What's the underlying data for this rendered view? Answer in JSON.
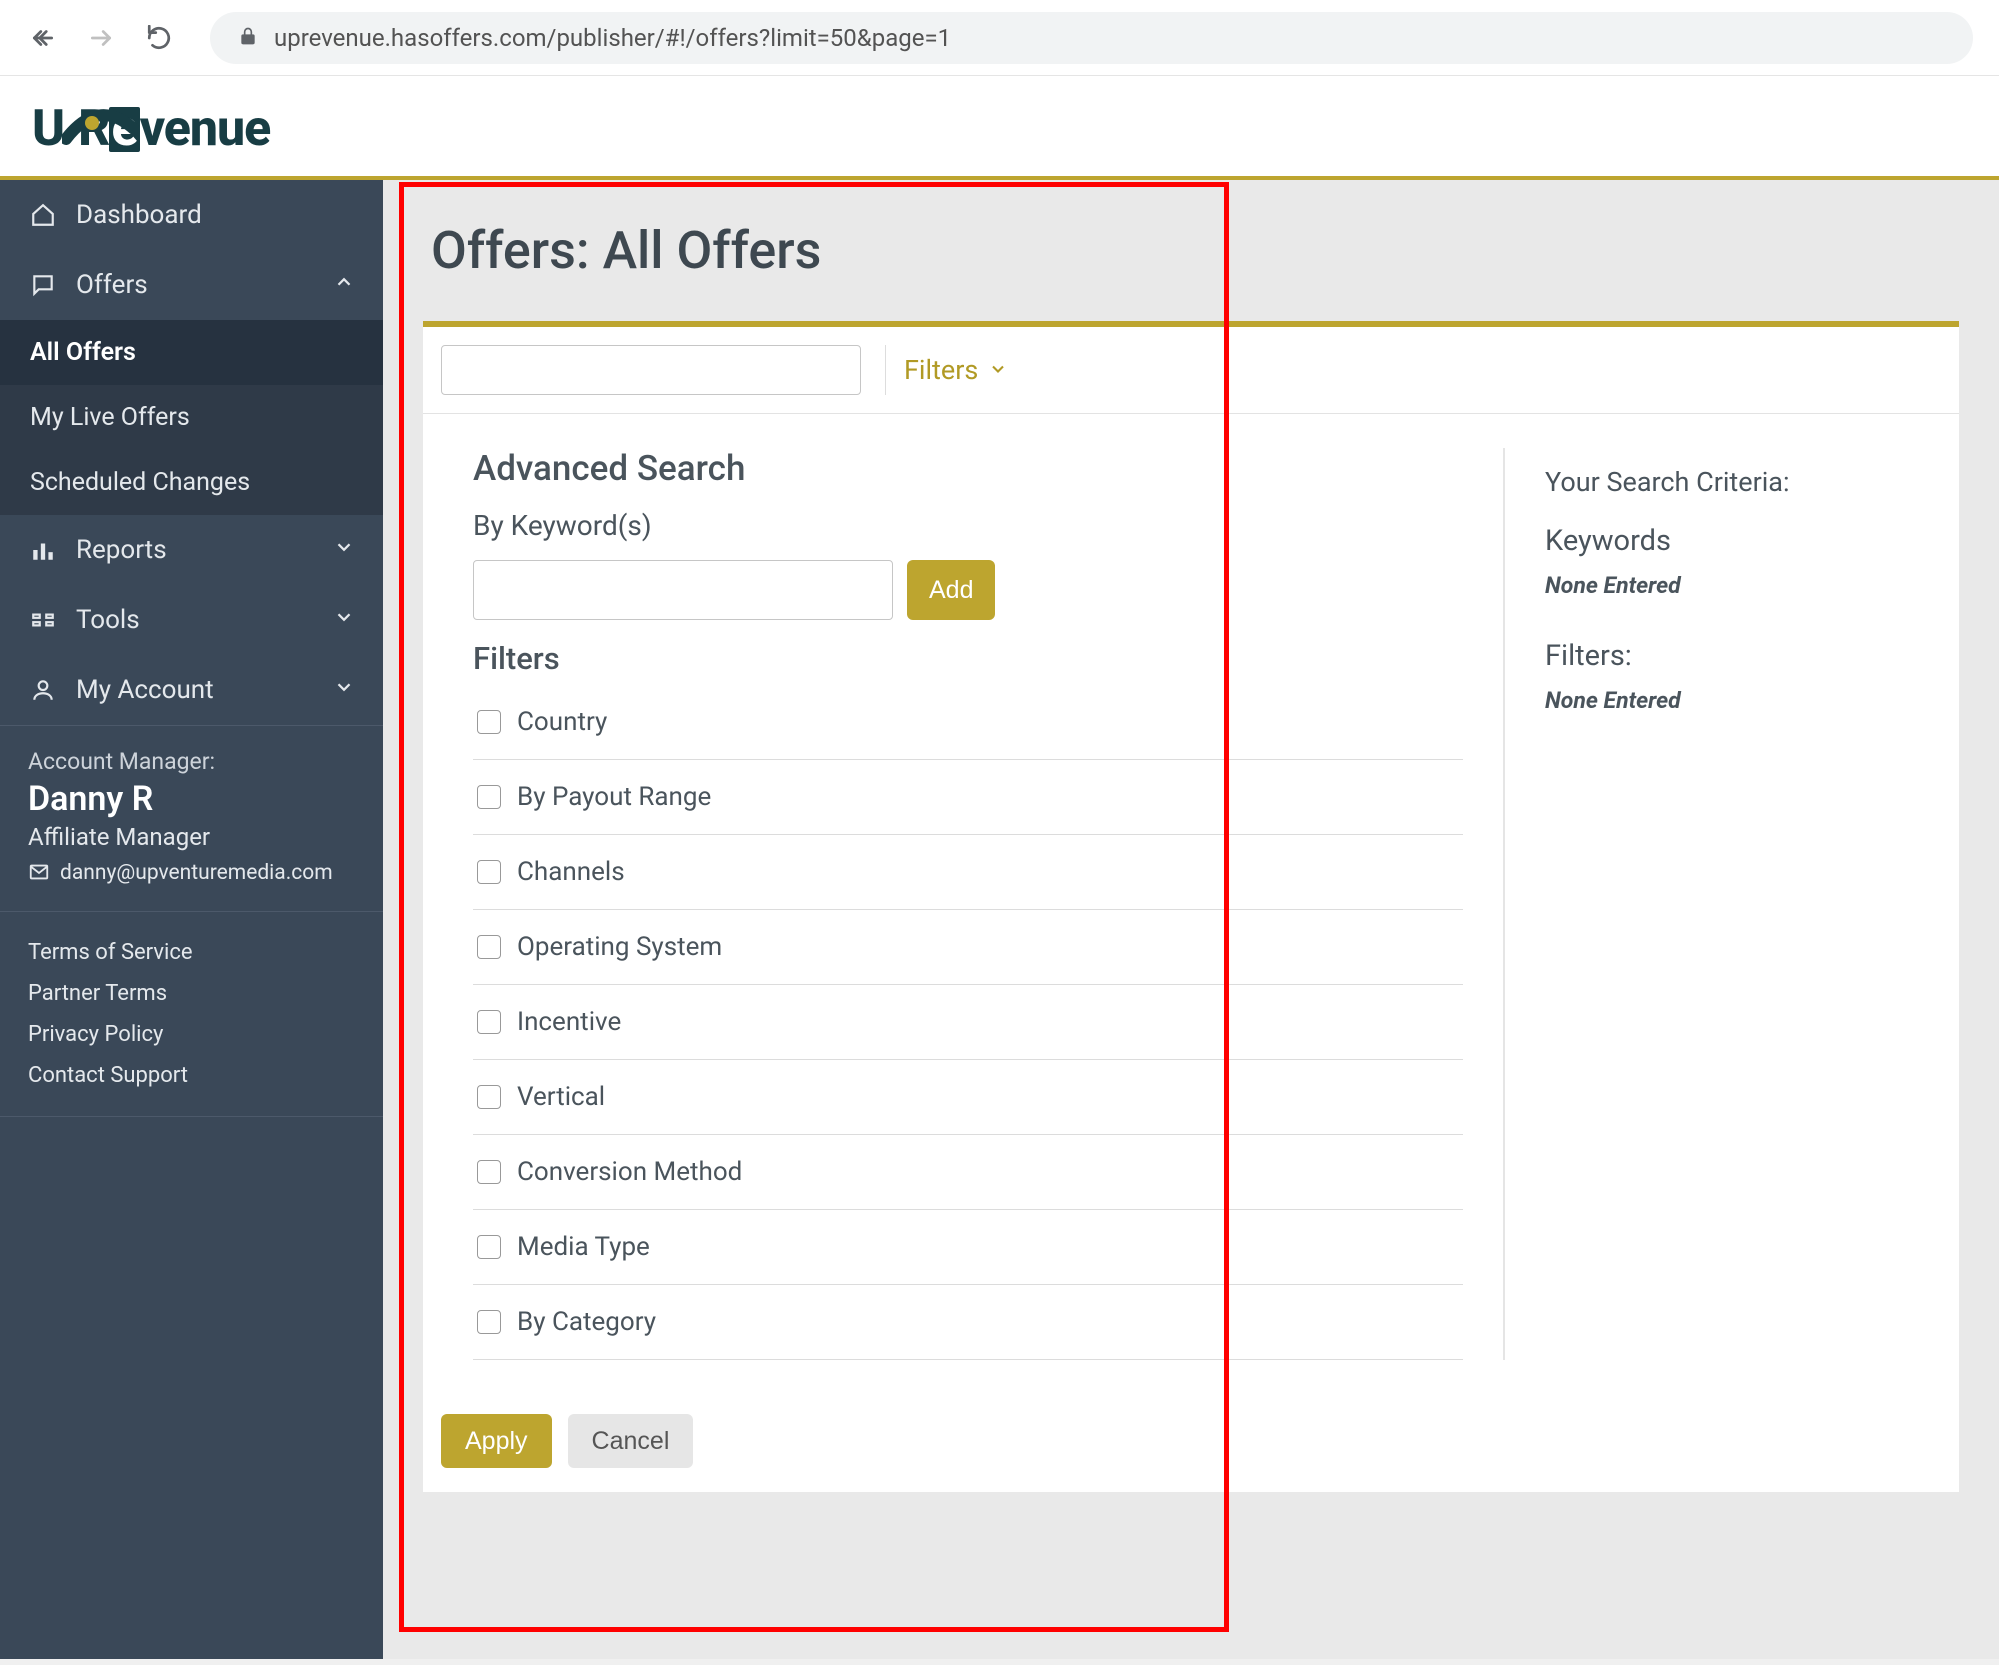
{
  "url": "uprevenue.hasoffers.com/publisher/#!/offers?limit=50&page=1",
  "logo_text": {
    "pre": "U",
    "mid": "R",
    "neg": "e",
    "post": "venue"
  },
  "sidebar": {
    "items": [
      {
        "icon": "home",
        "label": "Dashboard"
      },
      {
        "icon": "chat",
        "label": "Offers",
        "expanded": true,
        "children": [
          {
            "label": "All Offers",
            "active": true
          },
          {
            "label": "My Live Offers"
          },
          {
            "label": "Scheduled Changes"
          }
        ]
      },
      {
        "icon": "bars",
        "label": "Reports"
      },
      {
        "icon": "tools",
        "label": "Tools"
      },
      {
        "icon": "user",
        "label": "My Account"
      }
    ],
    "account": {
      "mgr_label": "Account Manager:",
      "mgr_name": "Danny R",
      "mgr_role": "Affiliate Manager",
      "mgr_email": "danny@upventuremedia.com"
    },
    "legal": [
      "Terms of Service",
      "Partner Terms",
      "Privacy Policy",
      "Contact Support"
    ]
  },
  "page": {
    "title": "Offers: All Offers",
    "filters_toggle": "Filters",
    "advanced_title": "Advanced Search",
    "by_keywords": "By Keyword(s)",
    "add_btn": "Add",
    "filters_heading": "Filters",
    "filter_options": [
      "Country",
      "By Payout Range",
      "Channels",
      "Operating System",
      "Incentive",
      "Vertical",
      "Conversion Method",
      "Media Type",
      "By Category"
    ],
    "apply": "Apply",
    "cancel": "Cancel",
    "criteria_label": "Your Search Criteria:",
    "criteria": [
      {
        "head": "Keywords",
        "val": "None Entered"
      },
      {
        "head": "Filters:",
        "val": "None Entered"
      }
    ]
  }
}
